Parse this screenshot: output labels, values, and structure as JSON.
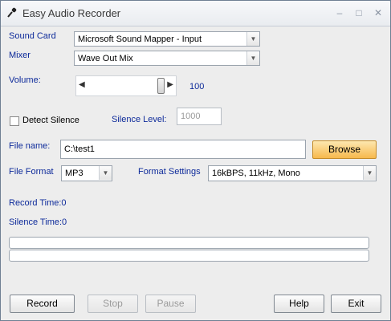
{
  "window": {
    "title": "Easy Audio Recorder"
  },
  "sound_card": {
    "label": "Sound Card",
    "value": "Microsoft Sound Mapper - Input"
  },
  "mixer": {
    "label": "Mixer",
    "value": "Wave Out Mix"
  },
  "volume": {
    "label": "Volume:",
    "value": "100",
    "level": 1.0
  },
  "detect_silence": {
    "label": "Detect Silence",
    "checked": false
  },
  "silence_level": {
    "label": "Silence Level:",
    "value": "1000"
  },
  "file_name": {
    "label": "File name:",
    "value": "C:\\test1",
    "browse_label": "Browse"
  },
  "file_format": {
    "label": "File Format",
    "value": "MP3"
  },
  "format_settings": {
    "label": "Format Settings",
    "value": "16kBPS, 11kHz, Mono"
  },
  "record_time": {
    "text": "Record Time:0"
  },
  "silence_time": {
    "text": "Silence Time:0"
  },
  "buttons": {
    "record": "Record",
    "stop": "Stop",
    "pause": "Pause",
    "help": "Help",
    "exit": "Exit"
  },
  "icons": {
    "app": "microphone-icon",
    "minimize": "minimize-icon",
    "maximize": "maximize-icon",
    "close": "close-icon"
  },
  "colors": {
    "label_blue": "#0d2a9a",
    "browse_orange": "#f7b94d"
  }
}
